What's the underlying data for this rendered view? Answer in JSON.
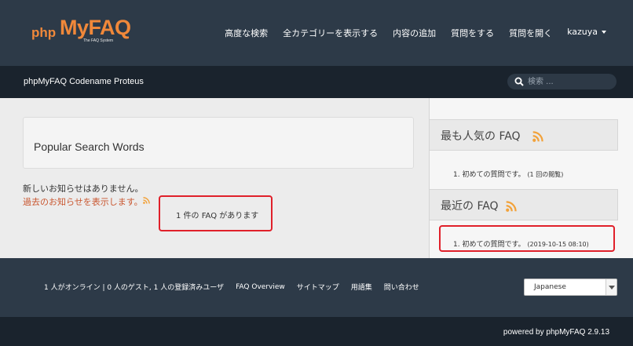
{
  "brand": {
    "logo_php": "php",
    "logo_myfaq": "MyFAQ",
    "logo_tagline": "The FAQ System",
    "accent_color": "#f0883a"
  },
  "nav": {
    "items": [
      {
        "label": "高度な検索"
      },
      {
        "label": "全カテゴリーを表示する"
      },
      {
        "label": "内容の追加"
      },
      {
        "label": "質問をする"
      },
      {
        "label": "質問を開く"
      },
      {
        "label": "kazuya"
      }
    ]
  },
  "subbar": {
    "site_name": "phpMyFAQ Codename Proteus",
    "search_placeholder": "検索 ..."
  },
  "main": {
    "card_title": "Popular Search Words",
    "no_news": "新しいお知らせはありません。",
    "past_news_link": "過去のお知らせを表示します。",
    "faq_count": "1 件の FAQ があります"
  },
  "sidebar": {
    "popular": {
      "title": "最も人気の FAQ",
      "item": "1. 初めての質問です。",
      "meta": "(1 回の閲覧)"
    },
    "recent": {
      "title": "最近の FAQ",
      "item": "1. 初めての質問です。",
      "meta": "(2019-10-15 08:10)"
    }
  },
  "footer": {
    "online": "1 人がオンライン | 0 人のゲスト, 1 人の登録済みユーザ",
    "links": [
      {
        "label": "FAQ Overview"
      },
      {
        "label": "サイトマップ"
      },
      {
        "label": "用語集"
      },
      {
        "label": "問い合わせ"
      }
    ],
    "language_selected": "Japanese",
    "powered": "powered by phpMyFAQ 2.9.13"
  },
  "icons": {
    "rss": "rss-icon",
    "search": "search-icon",
    "caret": "chevron-down-icon"
  },
  "colors": {
    "header_bg": "#2d3a48",
    "subbar_bg": "#1a232d",
    "highlight_border": "#e0202a",
    "link_red": "#c9562f",
    "rss_orange": "#f2a23a"
  }
}
